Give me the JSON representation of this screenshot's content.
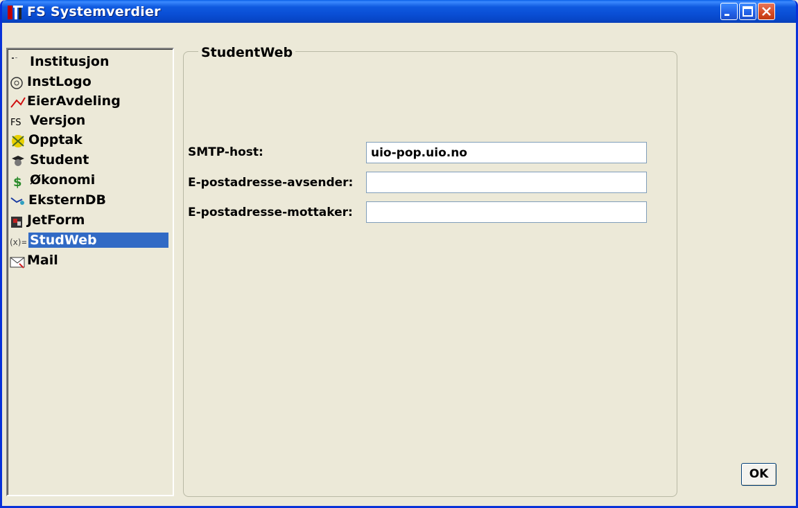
{
  "window": {
    "title": "FS Systemverdier",
    "controls": {
      "minimize": "minimize-icon",
      "maximize": "maximize-icon",
      "close": "close-icon"
    }
  },
  "sidebar": {
    "items": [
      {
        "label": "Institusjon",
        "icon": "institution-icon"
      },
      {
        "label": "InstLogo",
        "icon": "logo-icon"
      },
      {
        "label": "EierAvdeling",
        "icon": "owner-department-icon"
      },
      {
        "label": "Versjon",
        "icon": "fs-version-icon"
      },
      {
        "label": "Opptak",
        "icon": "admission-icon"
      },
      {
        "label": "Student",
        "icon": "student-icon"
      },
      {
        "label": "Økonomi",
        "icon": "dollar-icon"
      },
      {
        "label": "EksternDB",
        "icon": "external-db-icon"
      },
      {
        "label": "JetForm",
        "icon": "jetform-icon"
      },
      {
        "label": "StudWeb",
        "icon": "formula-icon",
        "selected": true
      },
      {
        "label": "Mail",
        "icon": "mail-icon"
      }
    ]
  },
  "group": {
    "title": "StudentWeb",
    "fields": [
      {
        "label": "SMTP-host:",
        "value": "uio-pop.uio.no"
      },
      {
        "label": "E-postadresse-avsender:",
        "value": ""
      },
      {
        "label": "E-postadresse-mottaker:",
        "value": ""
      }
    ]
  },
  "footer": {
    "ok_label": "OK"
  },
  "colors": {
    "selection": "#316ac5",
    "titlebar": "#0a4fd6",
    "window_bg": "#ece9d8"
  }
}
